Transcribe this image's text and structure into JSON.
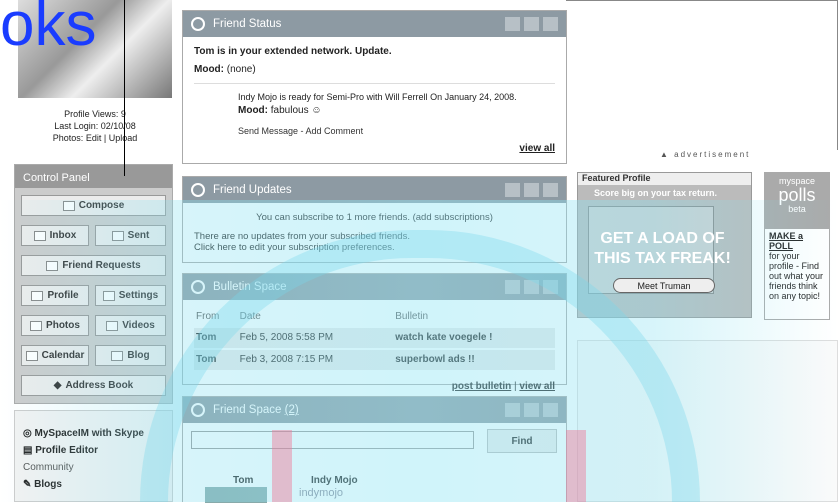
{
  "overlay_text": "oks",
  "profile": {
    "views": "Profile Views: 9",
    "last_login": "Last Login: 02/10/08",
    "photos_label": "Photos:",
    "edit": "Edit",
    "sep": "|",
    "upload": "Upload"
  },
  "control_panel": {
    "title": "Control Panel",
    "compose": "Compose",
    "inbox": "Inbox",
    "sent": "Sent",
    "friend_requests": "Friend Requests",
    "profile": "Profile",
    "settings": "Settings",
    "photos": "Photos",
    "videos": "Videos",
    "calendar": "Calendar",
    "blog": "Blog",
    "address_book": "Address Book"
  },
  "links": {
    "im": "MySpaceIM with Skype",
    "editor": "Profile Editor",
    "community": "Community",
    "blogs": "Blogs"
  },
  "friend_status": {
    "title": "Friend Status",
    "network_text": "Tom is in your extended network.",
    "update": "Update.",
    "mood_label": "Mood:",
    "mood_value": "(none)",
    "post_text": "Indy Mojo is ready for Semi-Pro with Will Ferrell",
    "post_date": "On January 24, 2008.",
    "post_mood_label": "Mood:",
    "post_mood": "fabulous",
    "send": "Send Message - Add Comment",
    "view_all": "view all"
  },
  "friend_updates": {
    "title": "Friend Updates",
    "subscribe_pre": "You can subscribe to 1 more friends.",
    "subscribe_link": "(add subscriptions)",
    "none": "There are no updates from your subscribed friends.",
    "edit": "Click here to edit your subscription preferences."
  },
  "bulletin": {
    "title": "Bulletin Space",
    "headers": [
      "From",
      "Date",
      "Bulletin"
    ],
    "rows": [
      [
        "Tom",
        "Feb 5, 2008 5:58 PM",
        "watch kate voegele !"
      ],
      [
        "Tom",
        "Feb 3, 2008 7:15 PM",
        "superbowl ads !!"
      ]
    ],
    "post": "post bulletin",
    "sep": "|",
    "view_all": "view all"
  },
  "friend_space": {
    "title": "Friend Space",
    "count": "(2)",
    "find": "Find",
    "friends": [
      "Tom",
      "Indy Mojo"
    ],
    "logo": "indymojo"
  },
  "ads": {
    "label": "advertisement",
    "featured": "Featured Profile",
    "score": "Score big on your tax return.",
    "big": "GET A LOAD OF THIS TAX FREAK!",
    "meet": "Meet Truman"
  },
  "polls": {
    "brand": "myspace",
    "title": "polls",
    "beta": "beta",
    "make": "MAKE a POLL",
    "desc": "for your profile - Find out what your friends think on any topic!"
  }
}
